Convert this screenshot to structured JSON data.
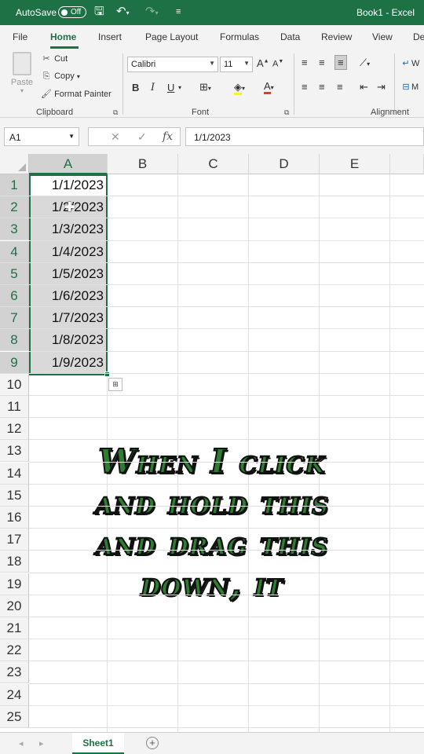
{
  "titlebar": {
    "autosave_label": "AutoSave",
    "autosave_state": "Off",
    "document_title": "Book1 - Excel",
    "icons": [
      "save-icon",
      "undo-icon",
      "redo-icon",
      "customize-qat-icon"
    ]
  },
  "ribbon_tabs": [
    "File",
    "Home",
    "Insert",
    "Page Layout",
    "Formulas",
    "Data",
    "Review",
    "View",
    "De"
  ],
  "active_tab": "Home",
  "clipboard": {
    "paste_label": "Paste",
    "cut_label": "Cut",
    "copy_label": "Copy",
    "format_painter_label": "Format Painter",
    "group_label": "Clipboard"
  },
  "font": {
    "font_name": "Calibri",
    "font_size": "11",
    "bold": "B",
    "italic": "I",
    "underline": "U",
    "group_label": "Font"
  },
  "alignment": {
    "group_label": "Alignment",
    "wrap_partial": "W",
    "merge_partial": "M"
  },
  "formula_bar": {
    "name_box": "A1",
    "fx_label": "fx",
    "formula_value": "1/1/2023"
  },
  "grid": {
    "columns": [
      "A",
      "B",
      "C",
      "D",
      "E"
    ],
    "selected_column": "A",
    "rows": [
      "1",
      "2",
      "3",
      "4",
      "5",
      "6",
      "7",
      "8",
      "9",
      "10",
      "11",
      "12",
      "13",
      "14",
      "15",
      "16",
      "17",
      "18",
      "19",
      "20",
      "21",
      "22",
      "23",
      "24",
      "25"
    ],
    "selected_rows": [
      "1",
      "2",
      "3",
      "4",
      "5",
      "6",
      "7",
      "8",
      "9"
    ],
    "cells_col_a": [
      "1/1/2023",
      "1/2/2023",
      "1/3/2023",
      "1/4/2023",
      "1/5/2023",
      "1/6/2023",
      "1/7/2023",
      "1/8/2023",
      "1/9/2023"
    ]
  },
  "caption": {
    "lines": [
      "When I click",
      "and hold this",
      "and drag this",
      "down, it"
    ]
  },
  "sheets": {
    "tabs": [
      "Sheet1"
    ],
    "active": "Sheet1"
  },
  "colors": {
    "excel_green": "#1e7145",
    "caption_green": "#2e7d32",
    "selection_fill": "#d9d9d9"
  }
}
